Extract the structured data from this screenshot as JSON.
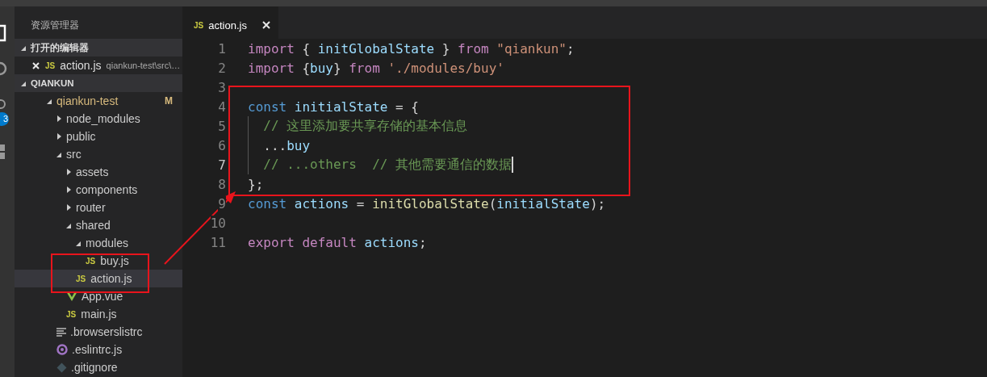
{
  "activity_bar": {
    "badge": "3"
  },
  "sidebar": {
    "title": "资源管理器",
    "open_editors": {
      "header": "打开的编辑器",
      "expanded": true,
      "items": [
        {
          "label": "action.js",
          "path": "qiankun-test\\src\\…",
          "icon_text": "JS"
        }
      ]
    },
    "workspace": {
      "header": "QIANKUN",
      "expanded": true,
      "tree": [
        {
          "label": "qiankun-test",
          "kind": "folder",
          "expanded": true,
          "selected": false,
          "modified": true,
          "badge": "M",
          "children": [
            {
              "label": "node_modules",
              "kind": "folder",
              "expanded": false,
              "selected": false
            },
            {
              "label": "public",
              "kind": "folder",
              "expanded": false,
              "selected": false
            },
            {
              "label": "src",
              "kind": "folder",
              "expanded": true,
              "selected": false,
              "children": [
                {
                  "label": "assets",
                  "kind": "folder",
                  "expanded": false,
                  "selected": false
                },
                {
                  "label": "components",
                  "kind": "folder",
                  "expanded": false,
                  "selected": false
                },
                {
                  "label": "router",
                  "kind": "folder",
                  "expanded": false,
                  "selected": false
                },
                {
                  "label": "shared",
                  "kind": "folder",
                  "expanded": true,
                  "selected": false,
                  "children": [
                    {
                      "label": "modules",
                      "kind": "folder",
                      "expanded": true,
                      "selected": false,
                      "children": [
                        {
                          "label": "buy.js",
                          "kind": "js",
                          "icon_text": "JS",
                          "selected": false
                        }
                      ]
                    },
                    {
                      "label": "action.js",
                      "kind": "js",
                      "icon_text": "JS",
                      "selected": true
                    }
                  ]
                },
                {
                  "label": "App.vue",
                  "kind": "vue",
                  "selected": false
                },
                {
                  "label": "main.js",
                  "kind": "js",
                  "icon_text": "JS",
                  "selected": false
                }
              ]
            },
            {
              "label": ".browserslistrc",
              "kind": "config",
              "selected": false
            },
            {
              "label": ".eslintrc.js",
              "kind": "eslint",
              "selected": false
            },
            {
              "label": ".gitignore",
              "kind": "git",
              "selected": false
            }
          ]
        }
      ]
    }
  },
  "tabs": [
    {
      "label": "action.js",
      "icon_text": "JS",
      "selected": true
    }
  ],
  "editor": {
    "lines": [
      {
        "number": "1",
        "current": false,
        "tokens": [
          {
            "text": "import",
            "kind": "keyword"
          },
          {
            "text": " { ",
            "kind": "punct"
          },
          {
            "text": "initGlobalState",
            "kind": "variable"
          },
          {
            "text": " } ",
            "kind": "punct"
          },
          {
            "text": "from ",
            "kind": "keyword"
          },
          {
            "text": "\"qiankun\"",
            "kind": "string"
          },
          {
            "text": ";",
            "kind": "punct"
          }
        ]
      },
      {
        "number": "2",
        "current": false,
        "tokens": [
          {
            "text": "import",
            "kind": "keyword"
          },
          {
            "text": " {",
            "kind": "punct"
          },
          {
            "text": "buy",
            "kind": "variable"
          },
          {
            "text": "} ",
            "kind": "punct"
          },
          {
            "text": "from ",
            "kind": "keyword"
          },
          {
            "text": "'./modules/buy'",
            "kind": "string"
          }
        ]
      },
      {
        "number": "3",
        "current": false
      },
      {
        "number": "4",
        "current": false,
        "tokens": [
          {
            "text": "const ",
            "kind": "storage"
          },
          {
            "text": "initialState",
            "kind": "variable"
          },
          {
            "text": " = {",
            "kind": "punct"
          }
        ]
      },
      {
        "number": "5",
        "guide": true,
        "current": false,
        "tokens": [
          {
            "text": "  // 这里添加要共享存储的基本信息",
            "kind": "comment"
          }
        ]
      },
      {
        "number": "6",
        "guide": true,
        "current": false,
        "tokens": [
          {
            "text": "  ...",
            "kind": "punct"
          },
          {
            "text": "buy",
            "kind": "variable"
          }
        ]
      },
      {
        "number": "7",
        "guide": true,
        "current": true,
        "tokens": [
          {
            "text": "  // ...others  // 其他需要通信的数据",
            "kind": "comment"
          }
        ]
      },
      {
        "number": "8",
        "current": false,
        "tokens": [
          {
            "text": "};",
            "kind": "punct"
          }
        ]
      },
      {
        "number": "9",
        "current": false,
        "tokens": [
          {
            "text": "const ",
            "kind": "storage"
          },
          {
            "text": "actions",
            "kind": "variable"
          },
          {
            "text": " = ",
            "kind": "punct"
          },
          {
            "text": "initGlobalState",
            "kind": "function"
          },
          {
            "text": "(",
            "kind": "punct"
          },
          {
            "text": "initialState",
            "kind": "variable"
          },
          {
            "text": ");",
            "kind": "punct"
          }
        ]
      },
      {
        "number": "10",
        "current": false
      },
      {
        "number": "11",
        "current": false,
        "tokens": [
          {
            "text": "export default ",
            "kind": "keyword"
          },
          {
            "text": "actions",
            "kind": "variable"
          },
          {
            "text": ";",
            "kind": "punct"
          }
        ]
      }
    ]
  }
}
